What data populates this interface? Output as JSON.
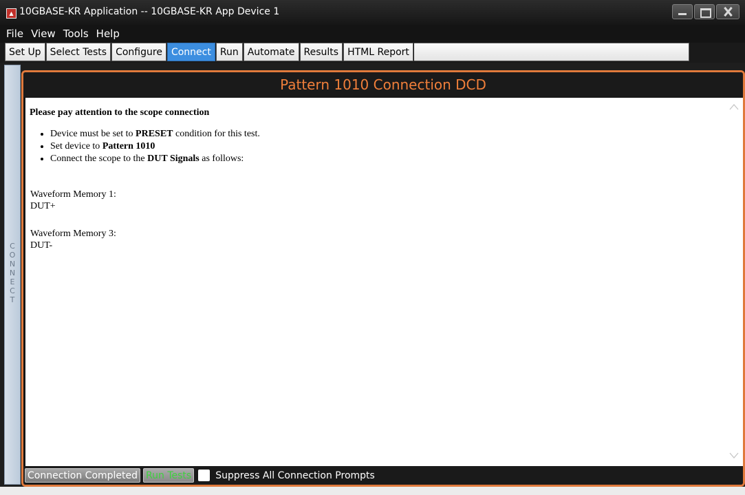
{
  "window": {
    "title": "10GBASE-KR Application -- 10GBASE-KR App Device 1"
  },
  "menu": [
    "File",
    "View",
    "Tools",
    "Help"
  ],
  "tabs": [
    {
      "label": "Set Up",
      "active": false
    },
    {
      "label": "Select Tests",
      "active": false
    },
    {
      "label": "Configure",
      "active": false
    },
    {
      "label": "Connect",
      "active": true
    },
    {
      "label": "Run",
      "active": false
    },
    {
      "label": "Automate",
      "active": false
    },
    {
      "label": "Results",
      "active": false
    },
    {
      "label": "HTML Report",
      "active": false
    }
  ],
  "side_label": "CONNECT",
  "panel": {
    "title": "Pattern 1010 Connection DCD",
    "heading": "Please pay attention to the scope connection",
    "bullets": [
      {
        "pre": "Device must be set to ",
        "bold": "PRESET",
        "post": " condition for this test."
      },
      {
        "pre": "Set device to ",
        "bold": "Pattern 1010",
        "post": ""
      },
      {
        "pre": "Connect the scope to the ",
        "bold": "DUT Signals",
        "post": " as follows:"
      }
    ],
    "memories": [
      {
        "label": "Waveform Memory 1:",
        "signal": "DUT+"
      },
      {
        "label": "Waveform Memory 3:",
        "signal": "DUT-"
      }
    ]
  },
  "bottom": {
    "connection_completed": "Connection Completed",
    "run_tests": "Run Tests",
    "suppress_label": "Suppress All Connection Prompts",
    "suppress_checked": false
  },
  "colors": {
    "accent_orange": "#e07a3c",
    "active_tab": "#3c8ee0",
    "run_text": "#3fd13f"
  }
}
